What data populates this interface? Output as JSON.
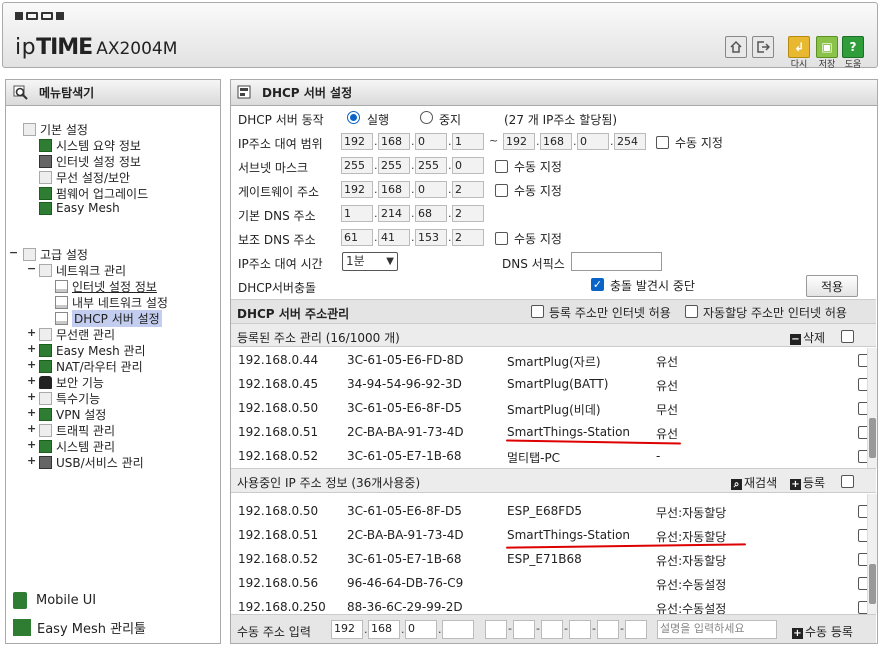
{
  "header": {
    "brand_ip": "ip",
    "brand_time": "TIME",
    "model": "AX2004M",
    "buttons": [
      {
        "label": "다시"
      },
      {
        "label": "저장"
      },
      {
        "label": "도움"
      }
    ]
  },
  "sidebar": {
    "title": "메뉴탐색기",
    "basic": {
      "label": "기본 설정",
      "items": [
        "시스템 요약 정보",
        "인터넷 설정 정보",
        "무선 설정/보안",
        "펌웨어 업그레이드",
        "Easy Mesh"
      ]
    },
    "advanced": {
      "label": "고급 설정",
      "network": "네트워크 관리",
      "network_items": [
        "인터넷 설정 정보",
        "내부 네트워크 설정",
        "DHCP 서버 설정"
      ],
      "items": [
        "무선랜 관리",
        "Easy Mesh 관리",
        "NAT/라우터 관리",
        "보안 기능",
        "특수기능",
        "VPN 설정",
        "트래픽 관리",
        "시스템 관리",
        "USB/서비스 관리"
      ]
    },
    "footer": [
      "Mobile UI",
      "Easy Mesh 관리툴"
    ]
  },
  "main": {
    "title": "DHCP 서버 설정",
    "server": {
      "label": "DHCP 서버 동작",
      "run": "실행",
      "stop": "중지",
      "note": "(27 개 IP주소 할당됨)"
    },
    "range": {
      "label": "IP주소 대여 범위",
      "start": [
        "192",
        "168",
        "0",
        "1"
      ],
      "end": [
        "192",
        "168",
        "0",
        "254"
      ],
      "manual": "수동 지정",
      "tilde": "~"
    },
    "subnet": {
      "label": "서브넷 마스크",
      "ip": [
        "255",
        "255",
        "255",
        "0"
      ],
      "manual": "수동 지정"
    },
    "gateway": {
      "label": "게이트웨이 주소",
      "ip": [
        "192",
        "168",
        "0",
        "2"
      ],
      "manual": "수동 지정"
    },
    "dns1": {
      "label": "기본 DNS 주소",
      "ip": [
        "1",
        "214",
        "68",
        "2"
      ]
    },
    "dns2": {
      "label": "보조 DNS 주소",
      "ip": [
        "61",
        "41",
        "153",
        "2"
      ],
      "manual": "수동 지정"
    },
    "lease": {
      "label": "IP주소 대여 시간",
      "value": "1분",
      "dns_suffix": "DNS 서픽스"
    },
    "conflict": {
      "label": "DHCP서버충돌",
      "stop": "충돌 발견시 중단",
      "apply": "적용"
    },
    "addr_mgmt": {
      "title": "DHCP 서버 주소관리",
      "opt1": "등록 주소만 인터넷 허용",
      "opt2": "자동할당 주소만 인터넷 허용"
    },
    "registered": {
      "title": "등록된 주소 관리 (16/1000 개)",
      "delete": "삭제",
      "rows": [
        {
          "ip": "192.168.0.44",
          "mac": "3C-61-05-E6-FD-8D",
          "name": "SmartPlug(자르)",
          "type": "유선"
        },
        {
          "ip": "192.168.0.45",
          "mac": "34-94-54-96-92-3D",
          "name": "SmartPlug(BATT)",
          "type": "유선"
        },
        {
          "ip": "192.168.0.50",
          "mac": "3C-61-05-E6-8F-D5",
          "name": "SmartPlug(비데)",
          "type": "무선"
        },
        {
          "ip": "192.168.0.51",
          "mac": "2C-BA-BA-91-73-4D",
          "name": "SmartThings-Station",
          "type": "유선"
        },
        {
          "ip": "192.168.0.52",
          "mac": "3C-61-05-E7-1B-68",
          "name": "멀티탭-PC",
          "type": "-"
        }
      ]
    },
    "inuse": {
      "title": "사용중인 IP 주소 정보 (36개사용중)",
      "rescan": "재검색",
      "register": "등록",
      "rows": [
        {
          "ip": "192.168.0.50",
          "mac": "3C-61-05-E6-8F-D5",
          "name": "ESP_E68FD5",
          "type": "무선:자동할당"
        },
        {
          "ip": "192.168.0.51",
          "mac": "2C-BA-BA-91-73-4D",
          "name": "SmartThings-Station",
          "type": "유선:자동할당"
        },
        {
          "ip": "192.168.0.52",
          "mac": "3C-61-05-E7-1B-68",
          "name": "ESP_E71B68",
          "type": "유선:자동할당"
        },
        {
          "ip": "192.168.0.56",
          "mac": "96-46-64-DB-76-C9",
          "name": "",
          "type": "유선:수동설정"
        },
        {
          "ip": "192.168.0.250",
          "mac": "88-36-6C-29-99-2D",
          "name": "",
          "type": "유선:수동설정"
        }
      ]
    },
    "manual_entry": {
      "label": "수동 주소 입력",
      "ip": [
        "192",
        "168",
        "0",
        ""
      ],
      "placeholder": "설명을 입력하세요",
      "register": "수동 등록"
    }
  }
}
